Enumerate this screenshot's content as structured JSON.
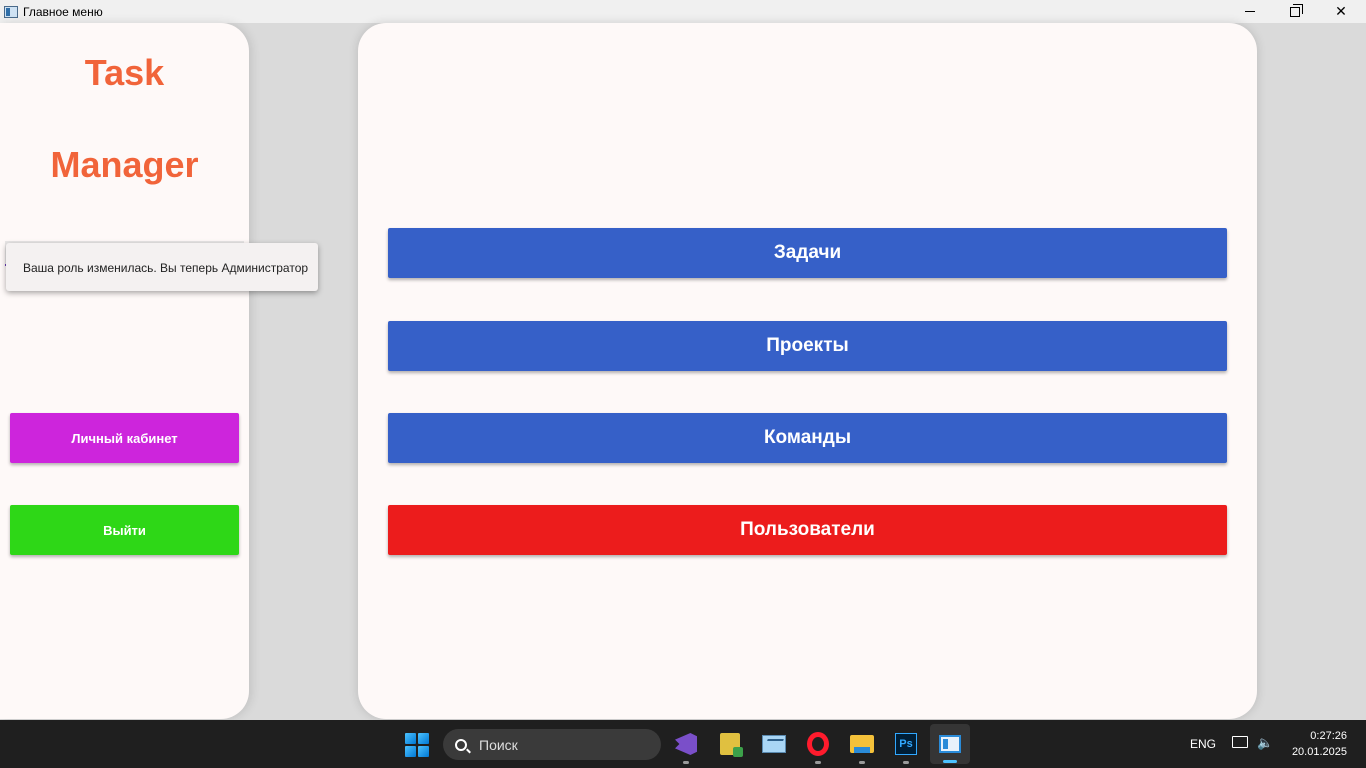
{
  "window": {
    "title": "Главное меню",
    "controls": [
      "minimize",
      "restore",
      "close"
    ]
  },
  "sidebar": {
    "logo_line1": "Task",
    "logo_line2": "Manager",
    "role_combo_value": "",
    "role_popup_text": "Ваша роль изменилась. Вы теперь Администратор",
    "cabinet_label": "Личный кабинет",
    "exit_label": "Выйти"
  },
  "main": {
    "buttons": [
      {
        "label": "Задачи",
        "color": "#3660c8"
      },
      {
        "label": "Проекты",
        "color": "#3660c8"
      },
      {
        "label": "Команды",
        "color": "#3660c8"
      },
      {
        "label": "Пользователи",
        "color": "#ec1c1c"
      }
    ]
  },
  "colors": {
    "logo": "#f1643a",
    "cabinet_button": "#cd25dc",
    "exit_button": "#2ed717",
    "accent_underline": "#673ab7"
  },
  "taskbar": {
    "search_placeholder": "Поиск",
    "pinned_icons": [
      "visual-studio-icon",
      "editor-icon",
      "monitor-icon",
      "opera-icon",
      "file-explorer-icon",
      "photoshop-icon",
      "app-window-icon"
    ],
    "photoshop_glyph": "Ps",
    "language": "ENG",
    "time": "0:27:26",
    "date": "20.01.2025"
  }
}
